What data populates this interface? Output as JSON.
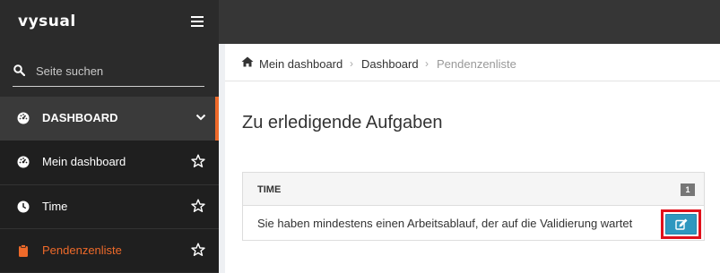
{
  "app": {
    "logo": "vysual"
  },
  "sidebar": {
    "search_placeholder": "Seite suchen",
    "items": [
      {
        "label": "DASHBOARD",
        "icon": "dashboard-icon"
      },
      {
        "label": "Mein dashboard",
        "icon": "dashboard-icon"
      },
      {
        "label": "Time",
        "icon": "clock-icon"
      },
      {
        "label": "Pendenzenliste",
        "icon": "clipboard-icon"
      }
    ]
  },
  "breadcrumb": {
    "items": [
      "Mein dashboard",
      "Dashboard",
      "Pendenzenliste"
    ]
  },
  "main": {
    "title": "Zu erledigende Aufgaben",
    "panel": {
      "heading": "TIME",
      "count": "1",
      "rows": [
        {
          "text": "Sie haben mindestens einen Arbeitsablauf, der auf die Validierung wartet"
        }
      ]
    }
  },
  "colors": {
    "accent": "#ee6a2a",
    "edit_button": "#2f97bf",
    "highlight_border": "#e0101b",
    "sidebar_bg": "#2b2b2b",
    "topbar_bg": "#363636"
  }
}
